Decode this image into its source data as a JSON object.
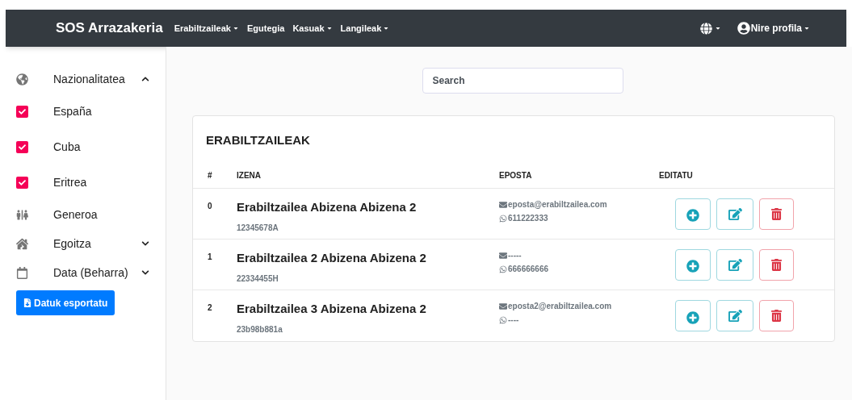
{
  "navbar": {
    "brand": "SOS Arrazakeria",
    "links": [
      {
        "label": "Erabiltzaileak",
        "dropdown": true
      },
      {
        "label": "Egutegia",
        "dropdown": false
      },
      {
        "label": "Kasuak",
        "dropdown": true
      },
      {
        "label": "Langileak",
        "dropdown": true
      }
    ],
    "profile": "Nire profila"
  },
  "sidebar": {
    "items": [
      {
        "kind": "group",
        "label": "Nazionalitatea",
        "expanded": true
      },
      {
        "kind": "checkbox",
        "label": "España",
        "checked": true
      },
      {
        "kind": "checkbox",
        "label": "Cuba",
        "checked": true
      },
      {
        "kind": "checkbox",
        "label": "Eritrea",
        "checked": true
      },
      {
        "kind": "plain",
        "label": "Generoa"
      },
      {
        "kind": "group",
        "label": "Egoitza",
        "expanded": false
      },
      {
        "kind": "group",
        "label": "Data (Beharra)",
        "expanded": false
      }
    ],
    "export_button": "Datuk esportatu"
  },
  "search": {
    "placeholder": "Search"
  },
  "table": {
    "title": "ERABILTZAILEAK",
    "columns": [
      "#",
      "IZENA",
      "EPOSTA",
      "EDITATU"
    ],
    "rows": [
      {
        "index": "0",
        "name": "Erabiltzailea Abizena Abizena 2",
        "id": "12345678A",
        "email": "eposta@erabiltzailea.com",
        "phone": "611222333"
      },
      {
        "index": "1",
        "name": "Erabiltzailea 2 Abizena Abizena 2",
        "id": "22334455H",
        "email": "-----",
        "phone": "666666666"
      },
      {
        "index": "2",
        "name": "Erabiltzailea 3 Abizena Abizena 2",
        "id": "23b98b881a",
        "email": "eposta2@erabiltzailea.com",
        "phone": "----"
      }
    ]
  }
}
